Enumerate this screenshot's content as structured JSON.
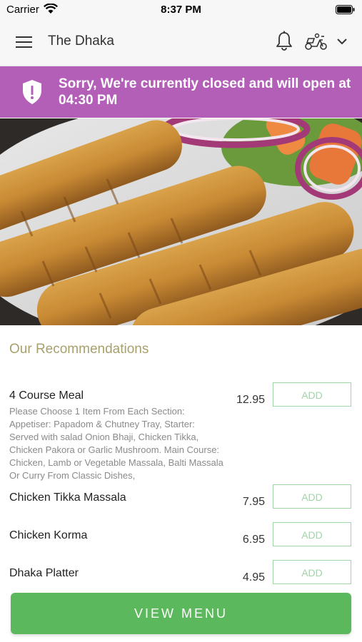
{
  "status_bar": {
    "carrier": "Carrier",
    "time": "8:37 PM"
  },
  "header": {
    "title": "The Dhaka"
  },
  "banner": {
    "message": "Sorry, We're currently closed and will open at 04:30 PM",
    "color": "#b35fb8"
  },
  "recommendations": {
    "title": "Our Recommendations",
    "items": [
      {
        "name": "4 Course Meal",
        "price": "12.95",
        "add_label": "ADD",
        "description": "Please Choose 1 Item From Each Section: Appetiser: Papadom & Chutney Tray, Starter: Served with salad Onion Bhaji, Chicken Tikka, Chicken Pakora or Garlic Mushroom. Main Course: Chicken, Lamb or Vegetable Massala, Balti Massala Or Curry From Classic Dishes,"
      },
      {
        "name": "Chicken Tikka Massala",
        "price": "7.95",
        "add_label": "ADD"
      },
      {
        "name": "Chicken Korma",
        "price": "6.95",
        "add_label": "ADD"
      },
      {
        "name": "Dhaka Platter",
        "price": "4.95",
        "add_label": "ADD"
      }
    ]
  },
  "footer": {
    "view_menu_label": "VIEW MENU",
    "accent": "#5cb85c"
  },
  "icons": [
    "menu-icon",
    "bell-icon",
    "scooter-icon",
    "chevron-down-icon",
    "shield-icon",
    "wifi-icon",
    "battery-icon"
  ]
}
